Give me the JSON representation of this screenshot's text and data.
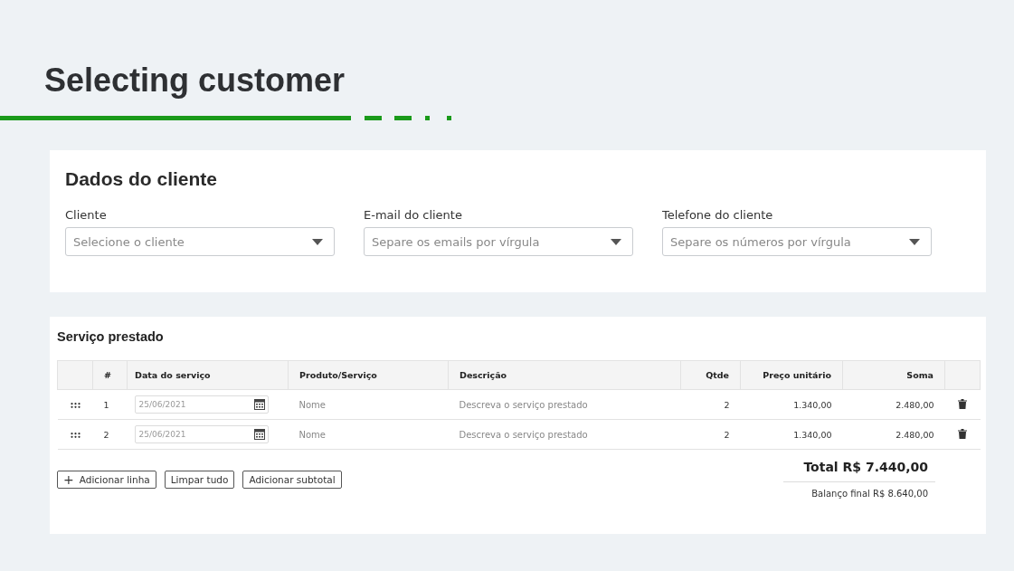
{
  "slide_title": "Selecting customer",
  "customer_card": {
    "title": "Dados do cliente",
    "fields": [
      {
        "label": "Cliente",
        "placeholder": "Selecione o cliente"
      },
      {
        "label": "E-mail do cliente",
        "placeholder": "Separe os emails por vírgula"
      },
      {
        "label": "Telefone do cliente",
        "placeholder": "Separe os números por vírgula"
      }
    ]
  },
  "services_card": {
    "title": "Serviço prestado",
    "table": {
      "columns": [
        "#",
        "Data do serviço",
        "Produto/Serviço",
        "Descrição",
        "Qtde",
        "Preço unitário",
        "Soma"
      ],
      "rows": [
        {
          "number": "1",
          "date": "25/06/2021",
          "product_placeholder": "Nome",
          "description_placeholder": "Descreva o serviço prestado",
          "qty": "2",
          "unit_price": "1.340,00",
          "sum": "2.480,00"
        },
        {
          "number": "2",
          "date": "25/06/2021",
          "product_placeholder": "Nome",
          "description_placeholder": "Descreva o serviço prestado",
          "qty": "2",
          "unit_price": "1.340,00",
          "sum": "2.480,00"
        }
      ]
    },
    "buttons": [
      {
        "icon": "+",
        "label": "Adicionar linha"
      },
      {
        "label": "Limpar tudo"
      },
      {
        "label": "Adicionar subtotal"
      }
    ],
    "total": "Total R$ 7.440,00",
    "final_balance": "Balanço final R$ 8.640,00"
  }
}
